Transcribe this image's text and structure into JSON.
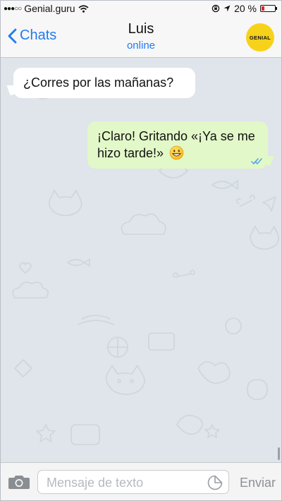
{
  "status_bar": {
    "carrier": "Genial.guru",
    "battery_text": "20 %",
    "battery_level": 0.2,
    "icons": [
      "signal-dots-icon",
      "wifi-icon",
      "lock-rotation-icon",
      "location-arrow-icon",
      "battery-icon"
    ]
  },
  "header": {
    "back_label": "Chats",
    "contact_name": "Luis",
    "contact_status": "online",
    "logo_text": "GENIAL",
    "accent_color": "#1f7bf2",
    "logo_color": "#f7d21a"
  },
  "messages": [
    {
      "direction": "incoming",
      "text": "¿Corres por las mañanas?",
      "bubble_color": "#ffffff"
    },
    {
      "direction": "outgoing",
      "text": "¡Claro! Gritando «¡Ya se me hizo tarde!»",
      "emoji": "grinning-face",
      "read_receipt": "double-check-icon",
      "bubble_color": "#e2f8c8"
    }
  ],
  "composer": {
    "placeholder": "Mensaje de texto",
    "value": "",
    "send_label": "Enviar",
    "icons": [
      "camera-icon",
      "sticker-icon"
    ]
  }
}
